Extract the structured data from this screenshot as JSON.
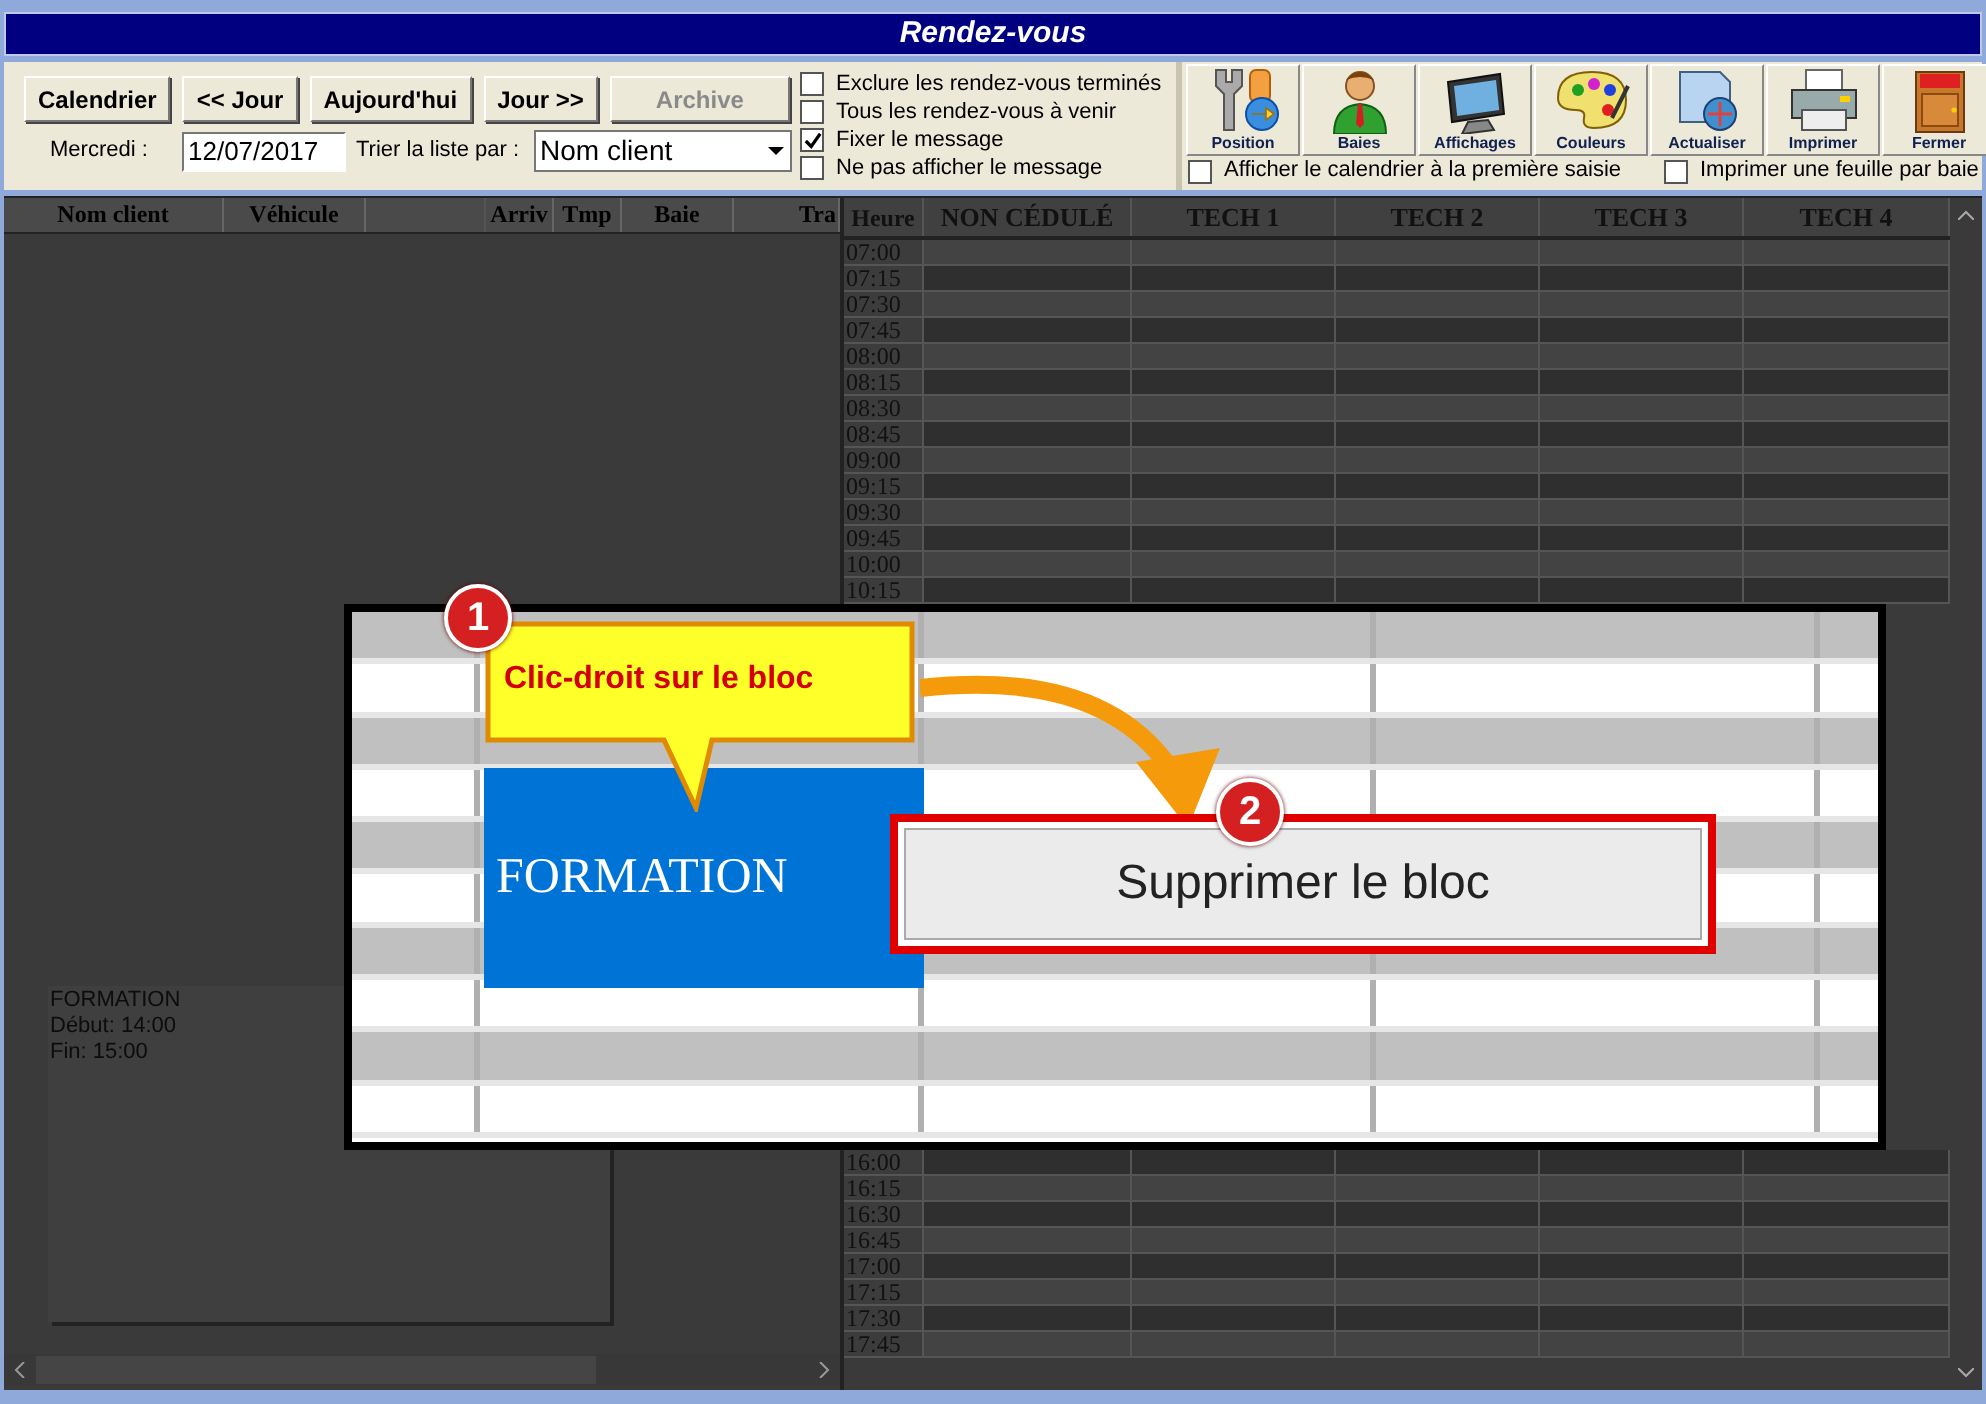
{
  "window": {
    "title": "Rendez-vous"
  },
  "toolbar": {
    "buttons": [
      {
        "label": "Calendrier",
        "disabled": false
      },
      {
        "label": "<< Jour",
        "disabled": false
      },
      {
        "label": "Aujourd'hui",
        "disabled": false
      },
      {
        "label": "Jour >>",
        "disabled": false
      },
      {
        "label": "Archive",
        "disabled": true
      }
    ],
    "day_label": "Mercredi :",
    "date": "12/07/2017",
    "sort_label": "Trier la liste par :",
    "sort_value": "Nom client",
    "options": [
      {
        "label": "Exclure les rendez-vous terminés",
        "checked": false
      },
      {
        "label": "Tous les rendez-vous à venir",
        "checked": false
      },
      {
        "label": "Fixer le message",
        "checked": true
      },
      {
        "label": "Ne pas afficher le message",
        "checked": false
      }
    ]
  },
  "tools": [
    {
      "label": "Position",
      "kind": "position"
    },
    {
      "label": "Baies",
      "kind": "person"
    },
    {
      "label": "Affichages",
      "kind": "monitor"
    },
    {
      "label": "Couleurs",
      "kind": "palette"
    },
    {
      "label": "Actualiser",
      "kind": "refresh"
    },
    {
      "label": "Imprimer",
      "kind": "printer"
    },
    {
      "label": "Fermer",
      "kind": "exit"
    }
  ],
  "tool_options": [
    {
      "label": "Afficher le calendrier à la première saisie",
      "checked": false
    },
    {
      "label": "Imprimer une feuille par baie",
      "checked": false
    }
  ],
  "list": {
    "columns": [
      "Nom client",
      "Véhicule",
      "Arriv",
      "Tmp",
      "Baie",
      "Tra"
    ]
  },
  "message": {
    "lines": [
      "FORMATION",
      "Début: 14:00",
      "Fin: 15:00"
    ]
  },
  "schedule": {
    "time_header": "Heure",
    "columns": [
      "NON CÉDULÉ",
      "TECH 1",
      "TECH 2",
      "TECH 3",
      "TECH 4"
    ],
    "times_top": [
      "07:00",
      "07:15",
      "07:30",
      "07:45",
      "08:00",
      "08:15",
      "08:30",
      "08:45",
      "09:00",
      "09:15",
      "09:30",
      "09:45",
      "10:00",
      "10:15"
    ],
    "times_bottom": [
      "16:00",
      "16:15",
      "16:30",
      "16:45",
      "17:00",
      "17:15",
      "17:30",
      "17:45"
    ]
  },
  "inset": {
    "block_label": "FORMATION",
    "callout": "Clic-droit sur le bloc",
    "menu_item": "Supprimer le bloc",
    "steps": [
      "1",
      "2"
    ]
  }
}
